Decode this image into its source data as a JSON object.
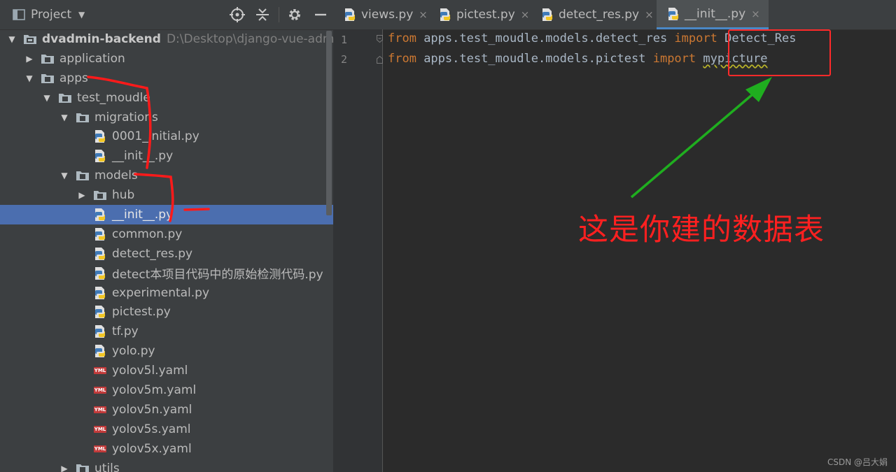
{
  "panel": {
    "title": "Project",
    "dropdown_icon": "triangle-down-icon",
    "toolbar_icons": [
      "locate-icon",
      "collapse-all-icon",
      "gear-icon",
      "minimize-icon"
    ]
  },
  "tree": [
    {
      "label": "dvadmin-backend",
      "path": "D:\\Desktop\\django-vue-admin-",
      "type": "module",
      "expanded": true
    },
    {
      "label": "application",
      "type": "folder",
      "expanded": false
    },
    {
      "label": "apps",
      "type": "folder",
      "expanded": true
    },
    {
      "label": "test_moudle",
      "type": "folder",
      "expanded": true
    },
    {
      "label": "migrations",
      "type": "folder",
      "expanded": true
    },
    {
      "label": "0001_initial.py",
      "type": "python"
    },
    {
      "label": "__init__.py",
      "type": "python"
    },
    {
      "label": "models",
      "type": "folder",
      "expanded": true
    },
    {
      "label": "hub",
      "type": "folder",
      "expanded": false
    },
    {
      "label": "__init__.py",
      "type": "python",
      "selected": true
    },
    {
      "label": "common.py",
      "type": "python"
    },
    {
      "label": "detect_res.py",
      "type": "python"
    },
    {
      "label": "detect本项目代码中的原始检测代码.py",
      "type": "python"
    },
    {
      "label": "experimental.py",
      "type": "python"
    },
    {
      "label": "pictest.py",
      "type": "python"
    },
    {
      "label": "tf.py",
      "type": "python"
    },
    {
      "label": "yolo.py",
      "type": "python"
    },
    {
      "label": "yolov5l.yaml",
      "type": "yaml"
    },
    {
      "label": "yolov5m.yaml",
      "type": "yaml"
    },
    {
      "label": "yolov5n.yaml",
      "type": "yaml"
    },
    {
      "label": "yolov5s.yaml",
      "type": "yaml"
    },
    {
      "label": "yolov5x.yaml",
      "type": "yaml"
    },
    {
      "label": "utils",
      "type": "folder",
      "expanded": false
    }
  ],
  "tabs": [
    {
      "label": "views.py",
      "active": false
    },
    {
      "label": "pictest.py",
      "active": false
    },
    {
      "label": "detect_res.py",
      "active": false
    },
    {
      "label": "__init__.py",
      "active": true
    }
  ],
  "tab_close_glyph": "×",
  "yaml_badge": "YML",
  "code": {
    "line_numbers": [
      "1",
      "2"
    ],
    "line1": {
      "kw1": "from",
      "module": " apps.test_moudle.models.detect_res ",
      "kw2": "import",
      "name": " Detect_Res"
    },
    "line2": {
      "kw1": "from",
      "module": " apps.test_moudle.models.pictest ",
      "kw2": "import",
      "name": "mypicture"
    }
  },
  "annotation": {
    "text": "这是你建的数据表"
  },
  "watermark": "CSDN @吕大娟",
  "colors": {
    "panel_bg": "#3c3f41",
    "editor_bg": "#2b2b2b",
    "selection": "#4b6eaf",
    "keyword": "#cc7832",
    "code_text": "#a9b7c6",
    "annotation_red": "#ff2020",
    "arrow_green": "#1fae1f"
  }
}
